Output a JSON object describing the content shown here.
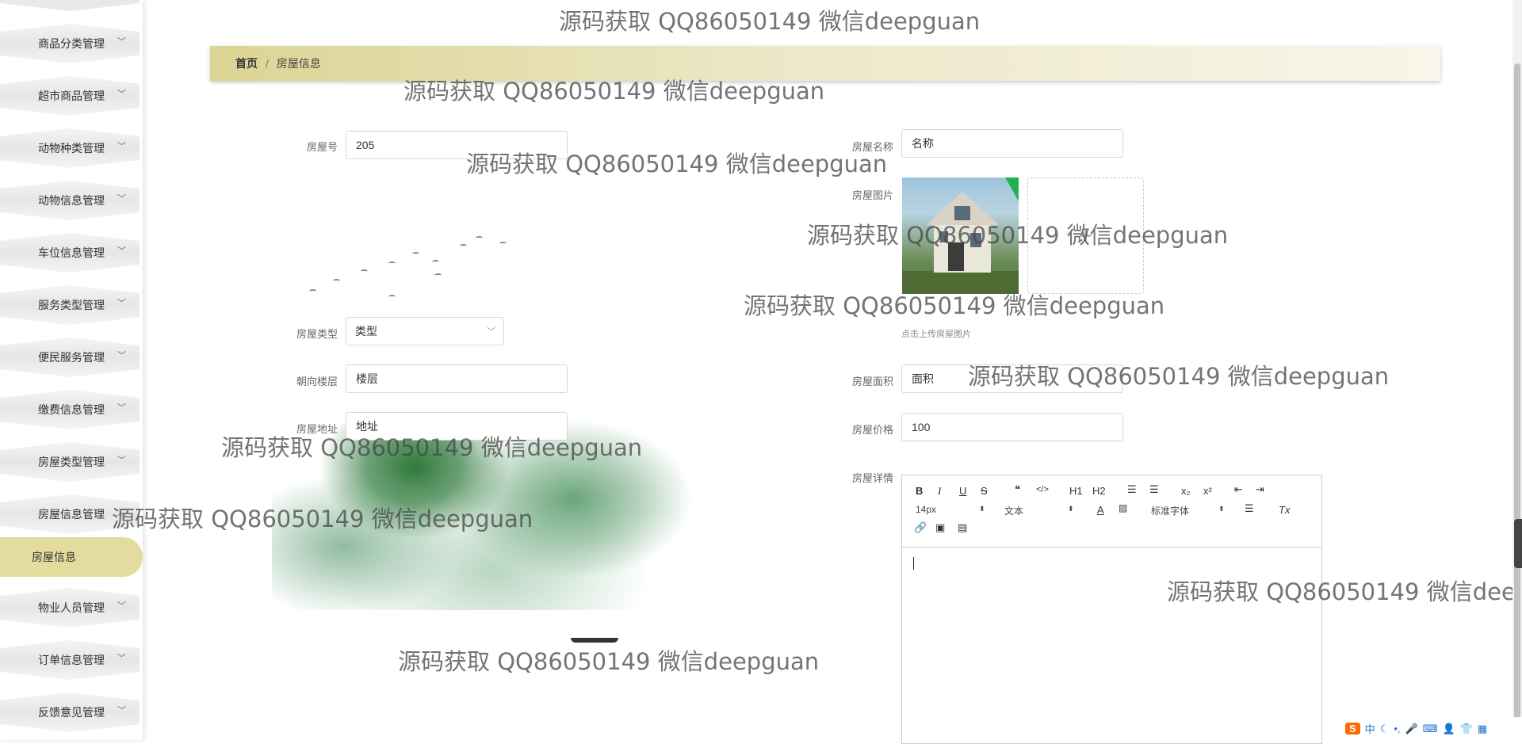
{
  "sidebar": {
    "items": [
      {
        "label": "商品分类管理"
      },
      {
        "label": "超市商品管理"
      },
      {
        "label": "动物种类管理"
      },
      {
        "label": "动物信息管理"
      },
      {
        "label": "车位信息管理"
      },
      {
        "label": "服务类型管理"
      },
      {
        "label": "便民服务管理"
      },
      {
        "label": "缴费信息管理"
      },
      {
        "label": "房屋类型管理"
      },
      {
        "label": "房屋信息管理"
      }
    ],
    "active_sub": {
      "label": "房屋信息"
    },
    "items_after": [
      {
        "label": "物业人员管理"
      },
      {
        "label": "订单信息管理"
      },
      {
        "label": "反馈意见管理"
      }
    ]
  },
  "breadcrumb": {
    "home": "首页",
    "separator": "/",
    "current": "房屋信息"
  },
  "form": {
    "house_no": {
      "label": "房屋号",
      "value": "205"
    },
    "house_name": {
      "label": "房屋名称",
      "value": "名称"
    },
    "house_image": {
      "label": "房屋图片",
      "tip": "点击上传房屋图片"
    },
    "house_type": {
      "label": "房屋类型",
      "value": "类型"
    },
    "orientation_floor": {
      "label": "朝向楼层",
      "value": "楼层"
    },
    "house_area": {
      "label": "房屋面积",
      "value": "面积"
    },
    "house_address": {
      "label": "房屋地址",
      "value": "地址"
    },
    "house_price": {
      "label": "房屋价格",
      "value": "100"
    },
    "house_detail": {
      "label": "房屋详情"
    }
  },
  "editor": {
    "font_size": "14px",
    "text_type": "文本",
    "font_family": "标准字体",
    "buttons": {
      "bold": "B",
      "italic": "I",
      "underline": "U",
      "strike": "S",
      "blockquote": "❝",
      "code": "</>",
      "h1": "H1",
      "h2": "H2",
      "sub": "x₂",
      "sup": "x²",
      "color": "A",
      "clear": "Tx"
    }
  },
  "watermark": "源码获取 QQ86050149 微信deepguan",
  "ime": {
    "logo": "S",
    "mode": "中"
  }
}
